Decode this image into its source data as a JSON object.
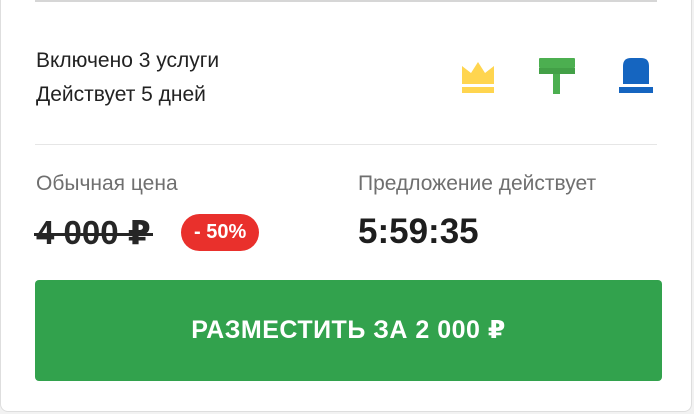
{
  "package": {
    "services_included": "Включено 3 услуги",
    "duration": "Действует 5 дней"
  },
  "icons": [
    {
      "name": "crown-icon",
      "color": "#ffd54f"
    },
    {
      "name": "paint-roller-icon",
      "color": "#4caf50"
    },
    {
      "name": "siren-icon",
      "color": "#1565c0"
    }
  ],
  "pricing": {
    "regular_label": "Обычная цена",
    "old_price": "4 000 ₽",
    "discount": "- 50%",
    "offer_label": "Предложение действует",
    "timer": "5:59:35"
  },
  "cta": {
    "label": "РАЗМЕСТИТЬ ЗА 2 000 ₽"
  },
  "colors": {
    "accent_green": "#32a24d",
    "discount_red": "#e9302c"
  }
}
